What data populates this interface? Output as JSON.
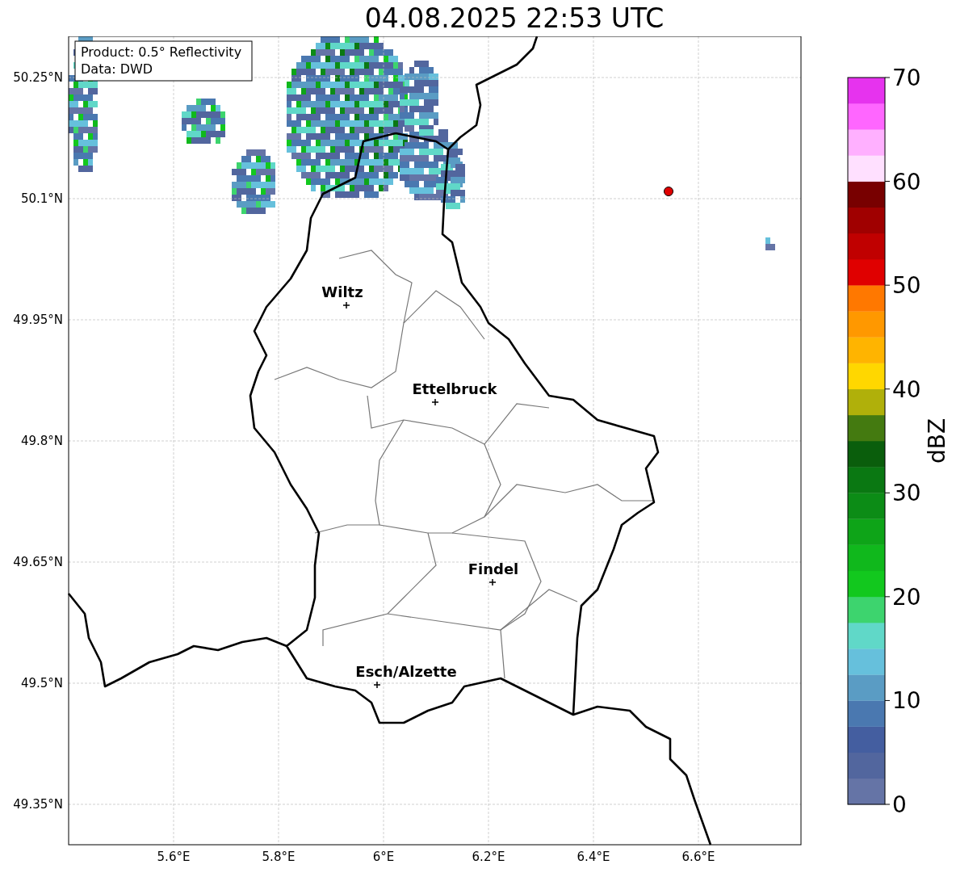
{
  "title": "04.08.2025 22:53 UTC",
  "info_box": [
    "Product: 0.5° Reflectivity",
    "Data: DWD"
  ],
  "map": {
    "lon_ticks": [
      "5.6°E",
      "5.8°E",
      "6°E",
      "6.2°E",
      "6.4°E",
      "6.6°E"
    ],
    "lat_ticks": [
      "50.25°N",
      "50.1°N",
      "49.95°N",
      "49.8°N",
      "49.65°N",
      "49.5°N",
      "49.35°N"
    ],
    "cities": [
      {
        "name": "Wiltz"
      },
      {
        "name": "Ettelbruck"
      },
      {
        "name": "Findel"
      },
      {
        "name": "Esch/Alzette"
      }
    ]
  },
  "colorbar": {
    "label": "dBZ",
    "ticks": [
      "70",
      "60",
      "50",
      "40",
      "30",
      "20",
      "10",
      "0"
    ],
    "bins": [
      {
        "color": "#6574a6"
      },
      {
        "color": "#52669e"
      },
      {
        "color": "#445ea0"
      },
      {
        "color": "#4a78b0"
      },
      {
        "color": "#5a9cc4"
      },
      {
        "color": "#66c0dc"
      },
      {
        "color": "#60d8c8"
      },
      {
        "color": "#3dd46e"
      },
      {
        "color": "#12c81e"
      },
      {
        "color": "#10b81c"
      },
      {
        "color": "#0ea418"
      },
      {
        "color": "#0c8c16"
      },
      {
        "color": "#0a7812"
      },
      {
        "color": "#0a5e0c"
      },
      {
        "color": "#447a10"
      },
      {
        "color": "#b0b00a"
      },
      {
        "color": "#ffd700"
      },
      {
        "color": "#ffb400"
      },
      {
        "color": "#ff9800"
      },
      {
        "color": "#ff7800"
      },
      {
        "color": "#e00000"
      },
      {
        "color": "#c00000"
      },
      {
        "color": "#a00000"
      },
      {
        "color": "#780000"
      },
      {
        "color": "#ffe0ff"
      },
      {
        "color": "#ffb0ff"
      },
      {
        "color": "#ff66ff"
      },
      {
        "color": "#e633ee"
      }
    ]
  }
}
